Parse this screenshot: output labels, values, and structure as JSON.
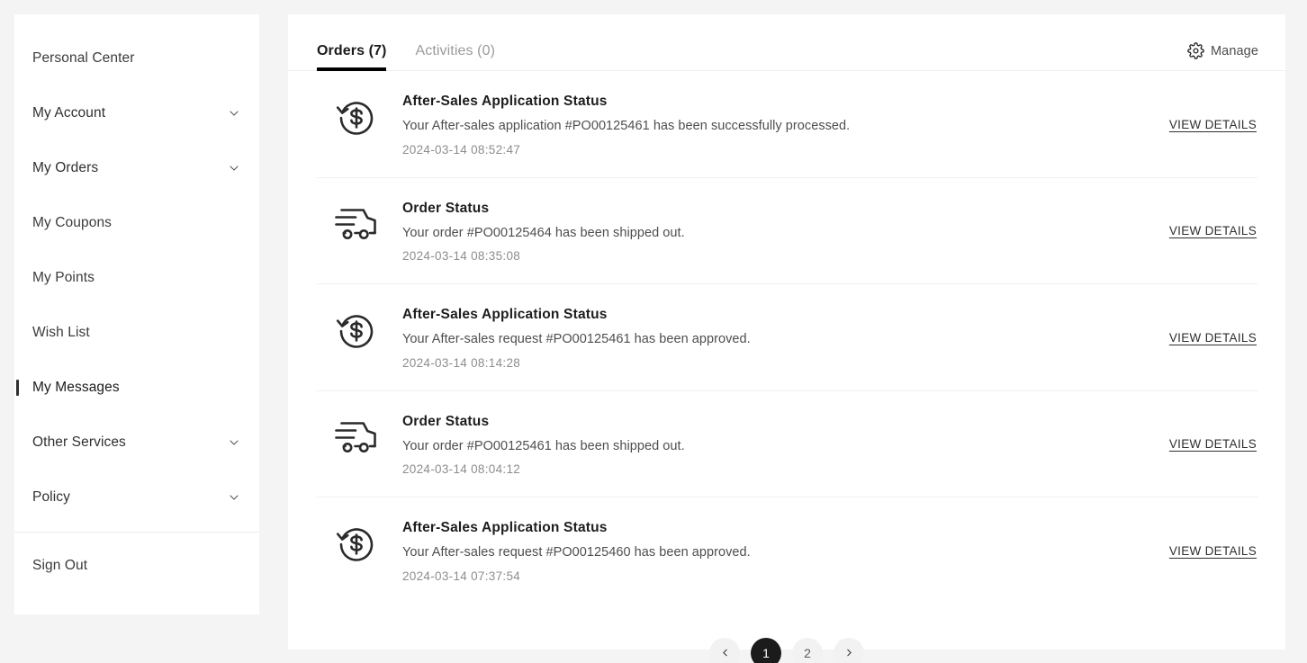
{
  "sidebar": {
    "items": [
      {
        "label": "Personal Center",
        "chevron": false,
        "active": false,
        "icon": ""
      },
      {
        "label": "My Account",
        "chevron": true,
        "active": false,
        "icon": "chevron-down-icon"
      },
      {
        "label": "My Orders",
        "chevron": true,
        "active": false,
        "icon": "chevron-down-icon"
      },
      {
        "label": "My Coupons",
        "chevron": false,
        "active": false,
        "icon": ""
      },
      {
        "label": "My Points",
        "chevron": false,
        "active": false,
        "icon": ""
      },
      {
        "label": "Wish List",
        "chevron": false,
        "active": false,
        "icon": ""
      },
      {
        "label": "My Messages",
        "chevron": false,
        "active": true,
        "icon": ""
      },
      {
        "label": "Other Services",
        "chevron": true,
        "active": false,
        "icon": "chevron-down-icon"
      },
      {
        "label": "Policy",
        "chevron": true,
        "active": false,
        "icon": "chevron-down-icon"
      }
    ],
    "sign_out": {
      "label": "Sign Out"
    }
  },
  "main": {
    "tabs": [
      {
        "label": "Orders (7)",
        "active": true
      },
      {
        "label": "Activities (0)",
        "active": false
      }
    ],
    "manage": {
      "label": "Manage",
      "icon": "gear-icon"
    },
    "messages": [
      {
        "icon": "refund-dollar-icon",
        "title": "After-Sales Application Status",
        "desc": "Your After-sales application #PO00125461 has been successfully processed.",
        "time": "2024-03-14 08:52:47",
        "action": "VIEW DETAILS"
      },
      {
        "icon": "delivery-truck-icon",
        "title": "Order Status",
        "desc": "Your order #PO00125464 has been shipped out.",
        "time": "2024-03-14 08:35:08",
        "action": "VIEW DETAILS"
      },
      {
        "icon": "refund-dollar-icon",
        "title": "After-Sales Application Status",
        "desc": "Your After-sales request #PO00125461 has been approved.",
        "time": "2024-03-14 08:14:28",
        "action": "VIEW DETAILS"
      },
      {
        "icon": "delivery-truck-icon",
        "title": "Order Status",
        "desc": "Your order #PO00125461 has been shipped out.",
        "time": "2024-03-14 08:04:12",
        "action": "VIEW DETAILS"
      },
      {
        "icon": "refund-dollar-icon",
        "title": "After-Sales Application Status",
        "desc": "Your After-sales request #PO00125460 has been approved.",
        "time": "2024-03-14 07:37:54",
        "action": "VIEW DETAILS"
      }
    ],
    "pagination": {
      "prev_icon": "chevron-left-icon",
      "next_icon": "chevron-right-icon",
      "pages": [
        {
          "label": "1",
          "active": true
        },
        {
          "label": "2",
          "active": false
        }
      ]
    }
  },
  "colors": {
    "page_background": "#f4f4f4",
    "card_background": "#ffffff",
    "accent": "#000000",
    "active_page": "#1b1b1b",
    "muted_text": "#8d8d8d"
  }
}
